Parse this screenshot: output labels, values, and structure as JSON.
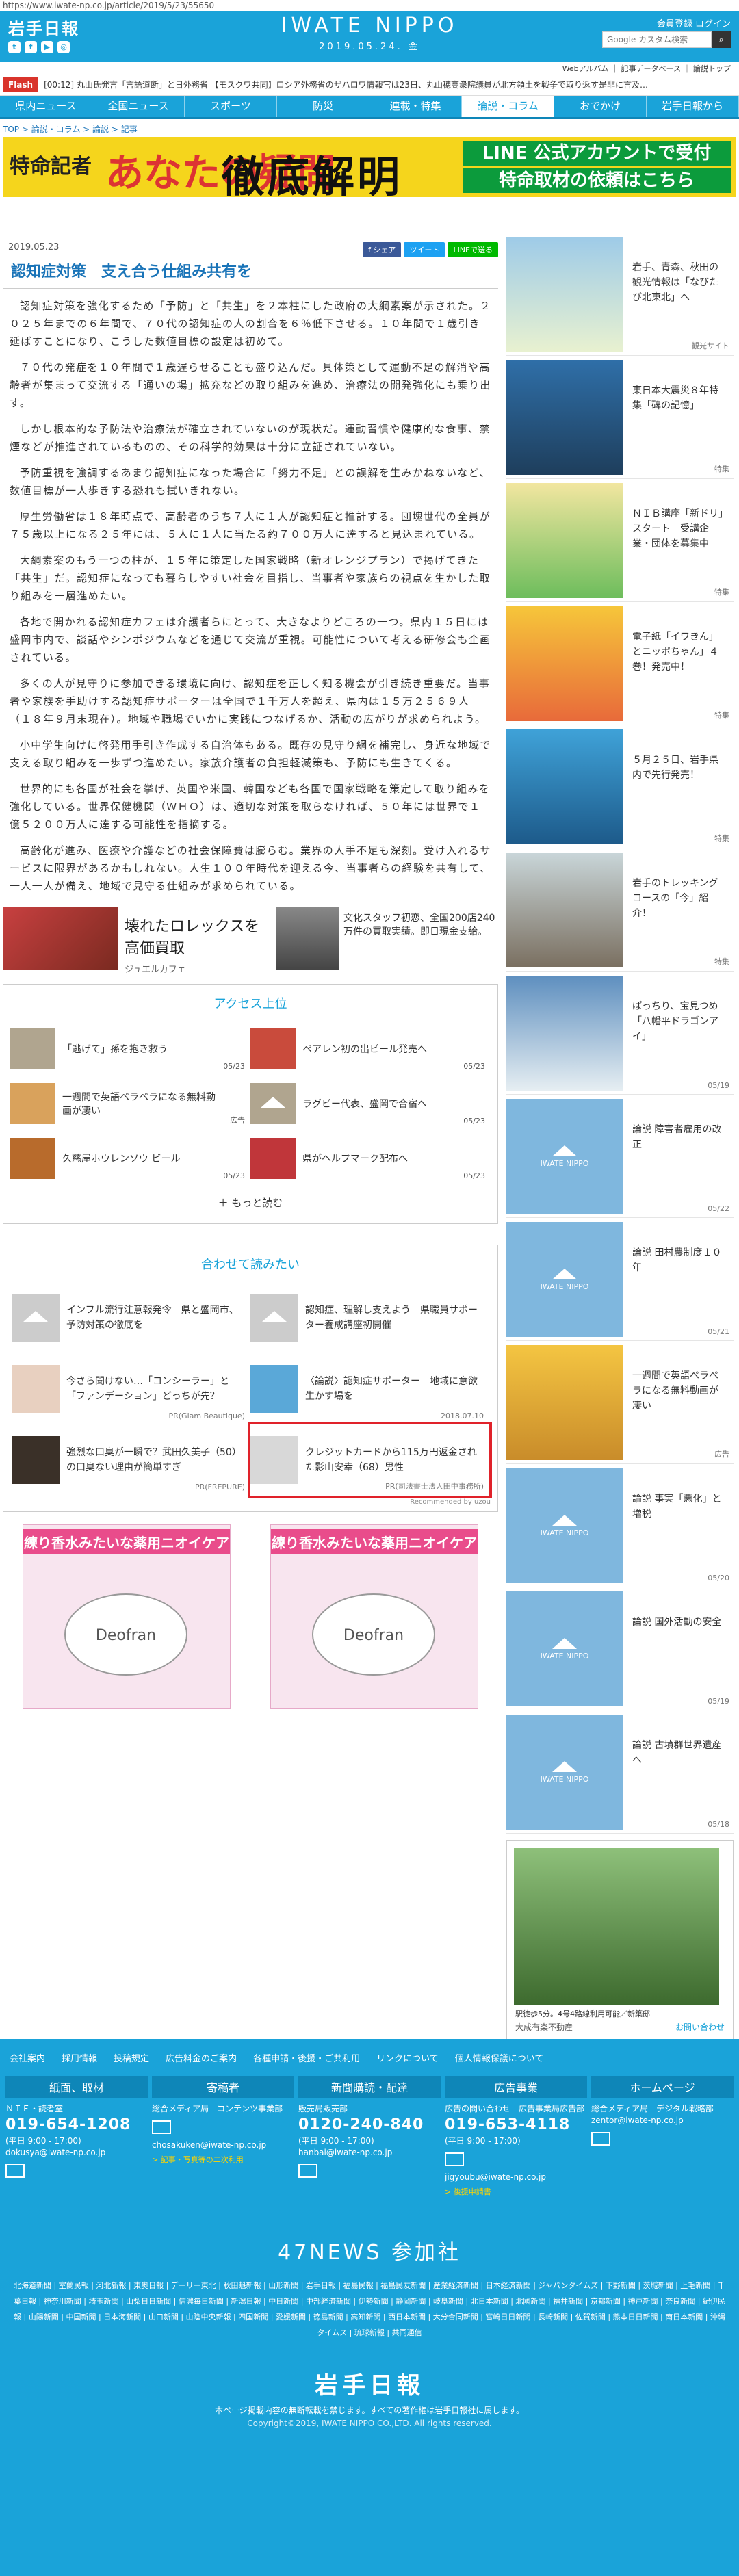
{
  "url": "https://www.iwate-np.co.jp/article/2019/5/23/55650",
  "header": {
    "logo": "岩手日報",
    "site": "IWATE NIPPO",
    "date": "2019.05.24. 金",
    "account": "会員登録 ログイン",
    "search_placeholder": "Google カスタム検索",
    "sublinks": "Webアルバム ｜ 記事データベース ｜ 論説トップ"
  },
  "flash": {
    "label": "Flash",
    "text": "[00:12] 丸山氏発言「言語道断」と日外務省 【モスクワ共同】ロシア外務省のザハロワ情報官は23日、丸山穂高衆院議員が北方領土を戦争で取り返す是非に言及…"
  },
  "nav": [
    "県内ニュース",
    "全国ニュース",
    "スポーツ",
    "防災",
    "連載・特集",
    "論説・コラム",
    "おでかけ",
    "岩手日報から"
  ],
  "nav_active": "論説・コラム",
  "breadcrumb": "TOP > 論説・コラム > 論説 > 記事",
  "banner": {
    "b1": "特命記者",
    "b2": "あなたの疑問",
    "b3": "徹底解明",
    "b4": "LINE 公式アカウントで受付",
    "b5": "特命取材の依頼はこちら"
  },
  "article": {
    "date": "2019.05.23",
    "share": [
      "f シェア",
      "ツイート",
      "LINEで送る"
    ],
    "title": "認知症対策　支え合う仕組み共有を",
    "paragraphs": [
      "認知症対策を強化するため「予防」と「共生」を２本柱にした政府の大綱素案が示された。２０２５年までの６年間で、７０代の認知症の人の割合を６％低下させる。１０年間で１歳引き延ばすことになり、こうした数値目標の設定は初めて。",
      "７０代の発症を１０年間で１歳遅らせることも盛り込んだ。具体策として運動不足の解消や高齢者が集まって交流する「通いの場」拡充などの取り組みを進め、治療法の開発強化にも乗り出す。",
      "しかし根本的な予防法や治療法が確立されていないのが現状だ。運動習慣や健康的な食事、禁煙などが推進されているものの、その科学的効果は十分に立証されていない。",
      "予防重視を強調するあまり認知症になった場合に「努力不足」との誤解を生みかねないなど、数値目標が一人歩きする恐れも拭いきれない。",
      "厚生労働省は１８年時点で、高齢者のうち７人に１人が認知症と推計する。団塊世代の全員が７５歳以上になる２５年には、５人に１人に当たる約７００万人に達すると見込まれている。",
      "大綱素案のもう一つの柱が、１５年に策定した国家戦略（新オレンジプラン）で掲げてきた「共生」だ。認知症になっても暮らしやすい社会を目指し、当事者や家族らの視点を生かした取り組みを一層進めたい。",
      "各地で開かれる認知症カフェは介護者らにとって、大きなよりどころの一つ。県内１５日には盛岡市内で、談話やシンポジウムなどを通じて交流が重視。可能性について考える研修会も企画されている。",
      "多くの人が見守りに参加できる環境に向け、認知症を正しく知る機会が引き続き重要だ。当事者や家族を手助けする認知症サポーターは全国で１千万人を超え、県内は１５万２５６９人（１８年９月末現在）。地域や職場でいかに実践につなげるか、活動の広がりが求められよう。",
      "小中学生向けに啓発用手引き作成する自治体もある。既存の見守り網を補完し、身近な地域で支える取り組みを一歩ずつ進めたい。家族介護者の負担軽減策も、予防にも生きてくる。",
      "世界的にも各国が社会を挙げ、英国や米国、韓国なども各国で国家戦略を策定して取り組みを強化している。世界保健機関（ＷＨＯ）は、適切な対策を取らなければ、５０年には世界で１億５２００万人に達する可能性を指摘する。",
      "高齢化が進み、医療や介護などの社会保障費は膨らむ。業界の人手不足も深刻。受け入れるサービスに限界があるかもしれない。人生１００年時代を迎える今、当事者らの経験を共有して、一人一人が備え、地域で見守る仕組みが求められている。"
    ]
  },
  "ad_top": {
    "title": "壊れたロレックスを高価買取",
    "sub": "ジュエルカフェ",
    "side_text": "文化スタッフ初恋、全国200店240万件の買取実績。即日現金支給。"
  },
  "access": {
    "heading": "アクセス上位",
    "items": [
      {
        "title": "「逃げて」孫を抱き救う",
        "date": "05/23"
      },
      {
        "title": "ペアレン初の出ビール発売へ",
        "date": "05/23"
      },
      {
        "title": "一週間で英語ペラペラになる無料動画が凄い",
        "date": "広告"
      },
      {
        "title": "ラグビー代表、盛岡で合宿へ",
        "date": "05/23"
      },
      {
        "title": "久慈屋ホウレンソウ ビール",
        "date": "05/23"
      },
      {
        "title": "県がヘルプマーク配布へ",
        "date": "05/23"
      }
    ],
    "more": "もっと読む"
  },
  "related": {
    "heading": "合わせて読みたい",
    "items": [
      {
        "title": "インフル流行注意報発令　県と盛岡市、予防対策の徹底を",
        "src": ""
      },
      {
        "title": "認知症、理解し支えよう　県職員サポーター養成講座初開催",
        "src": ""
      },
      {
        "title": "今さら聞けない…「コンシーラー」と「ファンデーション」どっちが先？",
        "src": "PR(Glam Beautique)"
      },
      {
        "title": "〈論説〉認知症サポーター　地域に意欲生かす場を",
        "src": "2018.07.10"
      },
      {
        "title": "強烈な口臭が一瞬で？武田久美子（50）の口臭ない理由が簡単すぎ",
        "src": "PR(FREPURE)"
      },
      {
        "title": "クレジットカードから115万円返金された影山安幸（68）男性",
        "src": "PR(司法書士法人田中事務所)"
      }
    ],
    "recommended": "Recommended by uzou"
  },
  "ad_big": {
    "label": "練り香水みたいな薬用ニオイケア",
    "brand": "Deofran"
  },
  "sidebar": [
    {
      "text": "岩手、青森、秋田の観光情報は「なびたび北東北」へ",
      "date": "観光サイト"
    },
    {
      "text": "東日本大震災８年特集「碑の記憶」",
      "date": "特集"
    },
    {
      "text": "ＮＩＢ講座「新ドリ」スタート　受講企業・団体を募集中",
      "date": "特集"
    },
    {
      "text": "電子紙「イワきん」とニッポちゃん」４巻！発売中！",
      "date": "特集"
    },
    {
      "text": "５月２５日、岩手県内で先行発売！",
      "date": "特集"
    },
    {
      "text": "岩手のトレッキングコースの「今」紹介！",
      "date": "特集"
    },
    {
      "text": "ぱっちり、宝見つめ「八幡平ドラゴンアイ」",
      "date": "05/19"
    },
    {
      "text": "論説 障害者雇用の改正",
      "date": "05/22"
    },
    {
      "text": "論説 田村農制度１０年",
      "date": "05/21"
    },
    {
      "text": "一週間で英語ペラペラになる無料動画が凄い",
      "date": "広告"
    },
    {
      "text": "論説 事実「悪化」と増税",
      "date": "05/20"
    },
    {
      "text": "論説 国外活動の安全",
      "date": "05/19"
    },
    {
      "text": "論説 古墳群世界遺産へ",
      "date": "05/18"
    }
  ],
  "side_ad": {
    "caption": "駅徒歩5分。4号4路線利用可能／新築邸",
    "footer": "大成有楽不動産",
    "link": "お問い合わせ"
  },
  "footer": {
    "links": [
      "会社案内",
      "採用情報",
      "投稿規定",
      "広告料金のご案内",
      "各種申請・後援・ご共利用",
      "リンクについて",
      "個人情報保護について"
    ],
    "cols": [
      {
        "hd": "紙面、取材",
        "ln": "ＮＩＥ・読者室",
        "tel": "019-654-1208",
        "hours": "(平日 9:00 - 17:00)",
        "mail": "dokusya@iwate-np.co.jp",
        "sub": ""
      },
      {
        "hd": "寄稿者",
        "ln": "総合メディア局　コンテンツ事業部",
        "tel": "",
        "hours": "",
        "mail": "chosakuken@iwate-np.co.jp",
        "sub": "> 記事・写真等の二次利用"
      },
      {
        "hd": "新聞購読・配達",
        "ln": "販売局販売部",
        "tel": "0120-240-840",
        "hours": "(平日 9:00 - 17:00)",
        "mail": "hanbai@iwate-np.co.jp",
        "sub": ""
      },
      {
        "hd": "広告事業",
        "ln": "広告の問い合わせ　広告事業局広告部",
        "tel": "019-653-4118",
        "hours": "(平日 9:00 - 17:00)",
        "mail": "jigyoubu@iwate-np.co.jp",
        "sub": "> 後援申請書"
      },
      {
        "hd": "ホームページ",
        "ln": "総合メディア局　デジタル戦略部",
        "tel": "",
        "hours": "",
        "mail": "zentor@iwate-np.co.jp",
        "sub": ""
      }
    ],
    "n47": "47NEWS 参加社",
    "n47list": "北海道新聞 | 室蘭民報 | 河北新報 | 東奥日報 | デーリー東北 | 秋田魁新報 | 山形新聞 | 岩手日報 | 福島民報 | 福島民友新聞 | 産業経済新聞 | 日本経済新聞 | ジャパンタイムズ | 下野新聞 | 茨城新聞 | 上毛新聞 | 千葉日報 | 神奈川新聞 | 埼玉新聞 | 山梨日日新聞 | 信濃毎日新聞 | 新潟日報 | 中日新聞 | 中部経済新聞 | 伊勢新聞 | 静岡新聞 | 岐阜新聞 | 北日本新聞 | 北國新聞 | 福井新聞 | 京都新聞 | 神戸新聞 | 奈良新聞 | 紀伊民報 | 山陽新聞 | 中国新聞 | 日本海新聞 | 山口新聞 | 山陰中央新報 | 四国新聞 | 愛媛新聞 | 徳島新聞 | 高知新聞 | 西日本新聞 | 大分合同新聞 | 宮崎日日新聞 | 長崎新聞 | 佐賀新聞 | 熊本日日新聞 | 南日本新聞 | 沖縄タイムス | 琉球新報 | 共同通信",
    "logo": "岩手日報",
    "copy1": "本ページ掲載内容の無断転載を禁じます。すべての著作権は岩手日報社に属します。",
    "copy2": "Copyright©2019, IWATE NIPPO CO.,LTD. All rights reserved."
  }
}
